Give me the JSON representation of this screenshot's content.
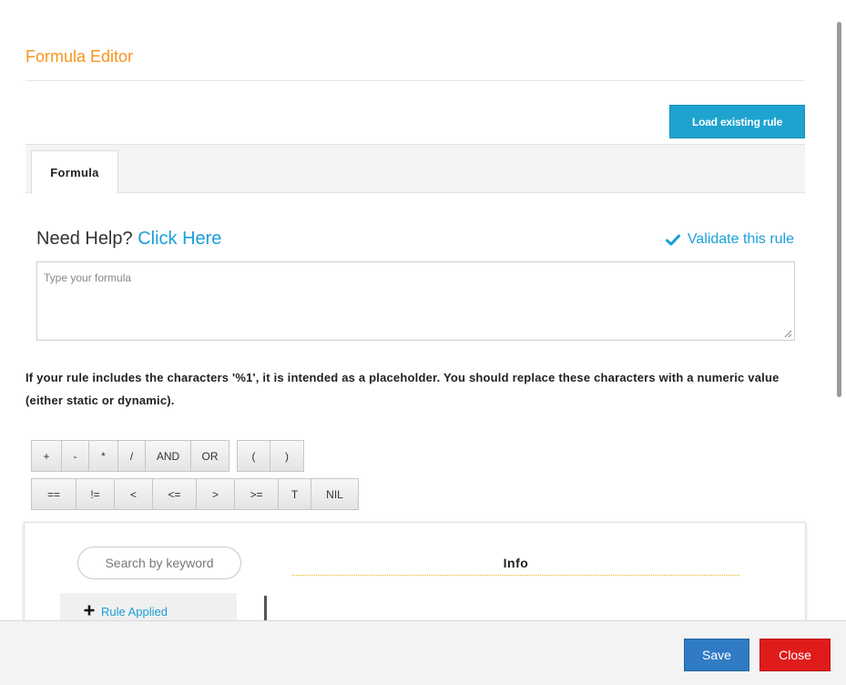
{
  "dialog": {
    "title": "Formula Editor",
    "load_button": "Load existing rule"
  },
  "tabs": [
    {
      "label": "Formula",
      "active": true
    }
  ],
  "help": {
    "prefix": "Need Help?",
    "link": "Click Here",
    "validate_label": "Validate this rule",
    "validate_icon": "check-icon"
  },
  "formula_input": {
    "value": "",
    "placeholder": "Type your formula"
  },
  "note": "If your rule includes the characters '%1', it is intended as a placeholder. You should replace these characters with a numeric value (either static or dynamic).",
  "operators": {
    "row1_group1": [
      "+",
      "-",
      "*",
      "/",
      "AND",
      "OR"
    ],
    "row1_group2": [
      "(",
      ")"
    ],
    "row2": [
      "==",
      "!=",
      "<",
      "<=",
      ">",
      ">=",
      "T",
      "NIL"
    ]
  },
  "panel": {
    "search_placeholder": "Search by keyword",
    "info_heading": "Info",
    "rule_item": "Rule Applied",
    "rule_icon": "plus-icon"
  },
  "footer": {
    "save": "Save",
    "close": "Close"
  },
  "colors": {
    "title": "#f7941d",
    "accent": "#1a9fd9",
    "save": "#2f7bc4",
    "close": "#e01b1b"
  }
}
